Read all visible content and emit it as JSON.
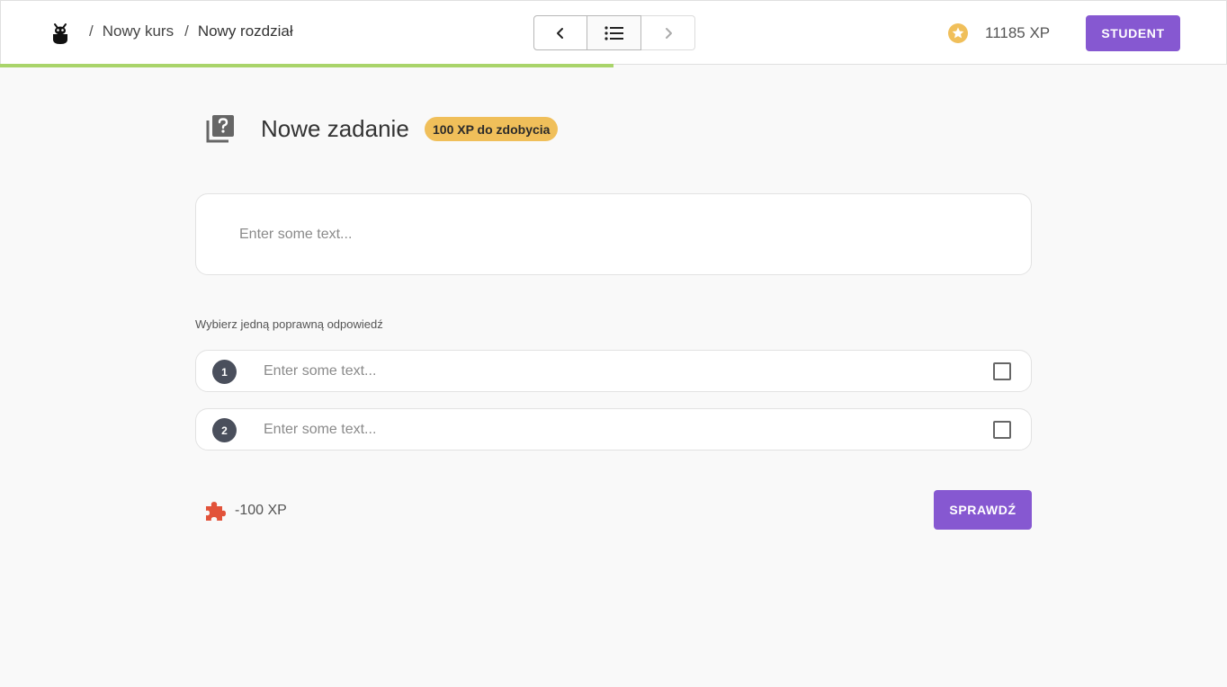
{
  "header": {
    "logo_icon": "beetle-logo-icon",
    "breadcrumbs": [
      {
        "label": "Nowy kurs"
      },
      {
        "label": "Nowy rozdział"
      }
    ],
    "separator": "/",
    "nav": {
      "prev_icon": "chevron-left-icon",
      "list_icon": "list-icon",
      "next_icon": "chevron-right-icon"
    },
    "xp_icon": "star-coin-icon",
    "xp_total": "11185 XP",
    "role_label": "STUDENT",
    "progress_fraction": 0.5
  },
  "task": {
    "icon": "question-library-icon",
    "title": "Nowe zadanie",
    "xp_badge": "100 XP do zdobycia",
    "question_placeholder": "Enter some text...",
    "instruction": "Wybierz jedną poprawną odpowiedź",
    "answers": [
      {
        "number": "1",
        "placeholder": "Enter some text...",
        "checked": false
      },
      {
        "number": "2",
        "placeholder": "Enter some text...",
        "checked": false
      }
    ],
    "hint_icon": "puzzle-piece-icon",
    "hint_cost": "-100 XP",
    "check_label": "SPRAWDŹ"
  },
  "colors": {
    "accent": "#8658d1",
    "progress": "#a9d46a",
    "badge": "#f0bf5a",
    "coin": "#f0bf5a",
    "hint": "#e2533a"
  }
}
